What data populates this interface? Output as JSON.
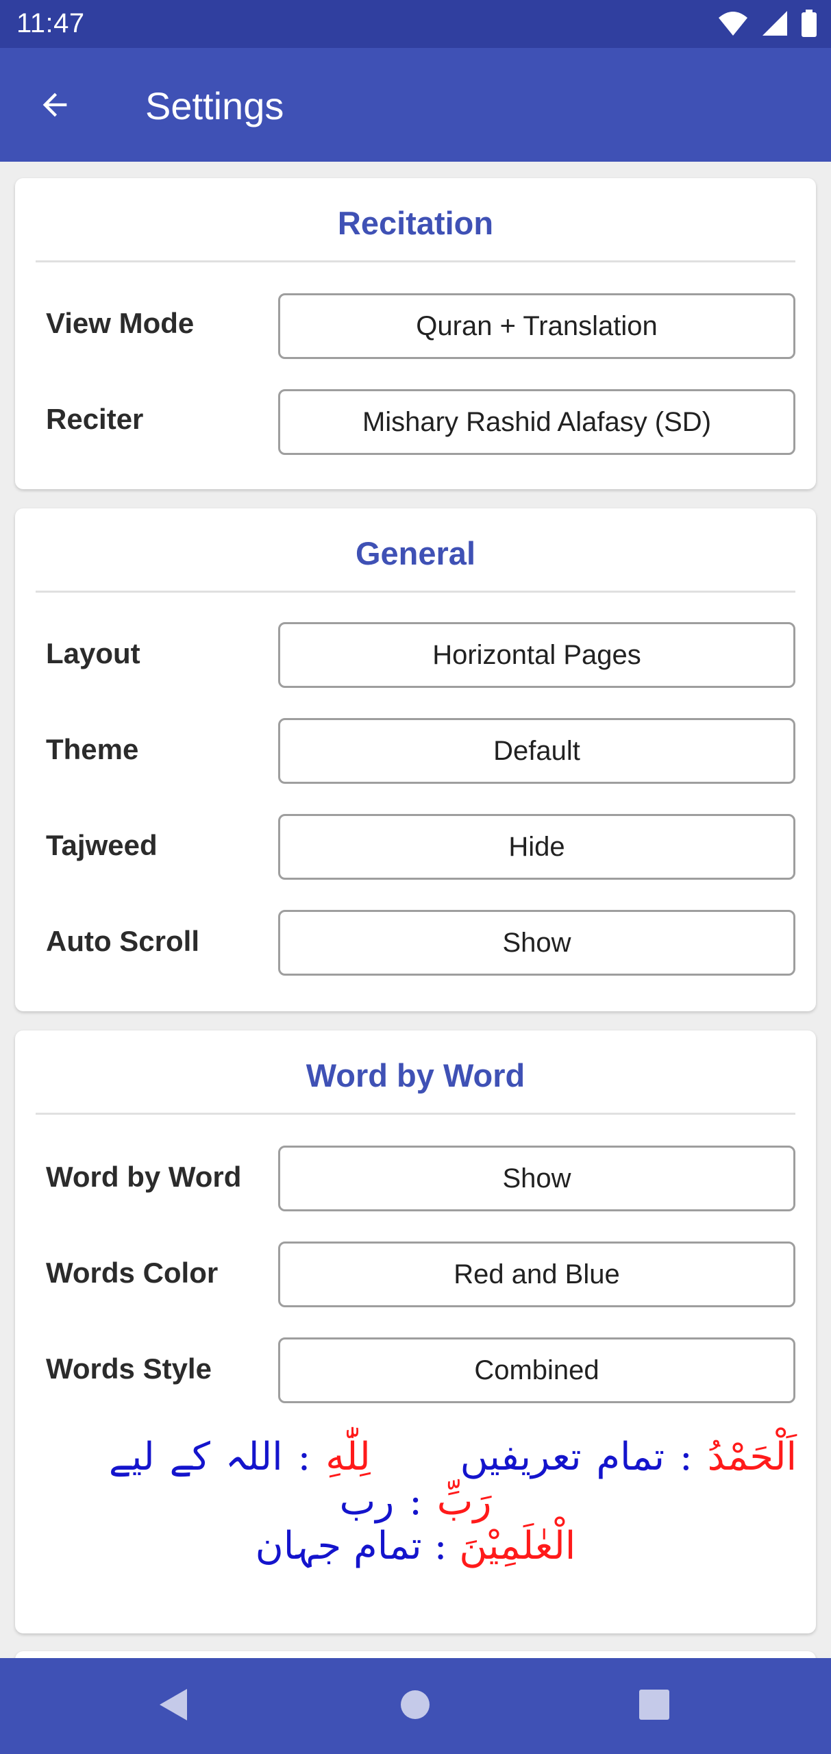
{
  "status_bar": {
    "time": "11:47"
  },
  "app_bar": {
    "title": "Settings"
  },
  "sections": {
    "recitation": {
      "title": "Recitation",
      "rows": [
        {
          "label": "View Mode",
          "value": "Quran + Translation"
        },
        {
          "label": "Reciter",
          "value": "Mishary Rashid Alafasy (SD)"
        }
      ]
    },
    "general": {
      "title": "General",
      "rows": [
        {
          "label": "Layout",
          "value": "Horizontal Pages"
        },
        {
          "label": "Theme",
          "value": "Default"
        },
        {
          "label": "Tajweed",
          "value": "Hide"
        },
        {
          "label": "Auto Scroll",
          "value": "Show"
        }
      ]
    },
    "word_by_word": {
      "title": "Word by Word",
      "rows": [
        {
          "label": "Word by Word",
          "value": "Show"
        },
        {
          "label": "Words Color",
          "value": "Red and Blue"
        },
        {
          "label": "Words Style",
          "value": "Combined"
        }
      ],
      "preview": {
        "pairs": [
          {
            "arabic": "اَلْحَمْدُ",
            "urdu": "تمام تعریفیں"
          },
          {
            "arabic": "لِلّٰهِ",
            "urdu": "اللہ کے لیے"
          },
          {
            "arabic": "رَبِّ",
            "urdu": "رب"
          },
          {
            "arabic": "الْعٰلَمِیْنَ",
            "urdu": "تمام جہان"
          }
        ],
        "separator": ":"
      }
    }
  },
  "colors": {
    "primary": "#3f51b5",
    "primary_dark": "#303f9f",
    "arabic_word": "#ff1a1a",
    "translation_word": "#1414cc"
  },
  "icons": {
    "back": "arrow-back-icon",
    "wifi": "wifi-icon",
    "signal": "signal-icon",
    "battery": "battery-icon",
    "nav_back": "triangle-back-icon",
    "nav_home": "circle-home-icon",
    "nav_recents": "square-recents-icon"
  }
}
